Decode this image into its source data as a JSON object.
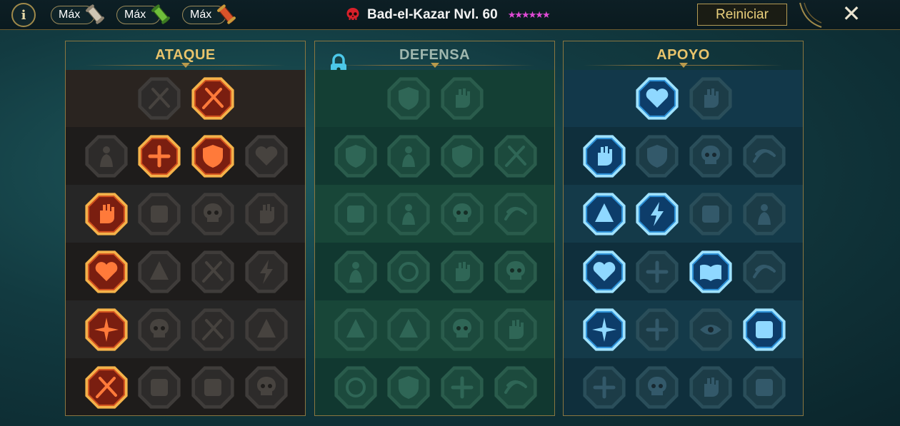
{
  "topbar": {
    "info_label": "i",
    "max_buttons": [
      {
        "label": "Máx",
        "scroll": "scroll-grey-icon"
      },
      {
        "label": "Máx",
        "scroll": "scroll-green-icon"
      },
      {
        "label": "Máx",
        "scroll": "scroll-red-icon"
      }
    ],
    "champion_name": "Bad-el-Kazar Nvl. 60",
    "stars": "★★★★★★",
    "reset_label": "Reiniciar",
    "close_label": "✕"
  },
  "panels": [
    {
      "key": "attack",
      "title": "ATAQUE",
      "locked": false,
      "active_color": "#d2501e",
      "rows": [
        [
          null,
          "swords-cross-icon",
          "flame-slash-icon",
          null
        ],
        [
          "horned-figure-icon",
          "triple-arrow-icon",
          "shield-arrow-icon",
          "cursed-heart-icon"
        ],
        [
          "fist-impact-icon",
          "fangs-icon",
          "skull-cloak-icon",
          "hand-claw-icon"
        ],
        [
          "bleeding-heart-icon",
          "gauntlet-icon",
          "axe-icon",
          "lightning-chains-icon"
        ],
        [
          "burst-strike-icon",
          "skull-group-icon",
          "sword-circle-icon",
          "warrior-stance-icon"
        ],
        [
          "sword-sparkle-icon",
          "knight-helm-icon",
          "demon-icon",
          "spartan-skull-icon"
        ]
      ],
      "active": [
        "0-2",
        "1-1",
        "1-2",
        "2-0",
        "3-0",
        "4-0",
        "5-0"
      ]
    },
    {
      "key": "defense",
      "title": "DEFENSA",
      "locked": true,
      "active_color": "#2a8a66",
      "rows": [
        [
          null,
          "armor-plate-icon",
          "raised-fist-icon",
          null
        ],
        [
          "tusk-shield-icon",
          "hooded-figure-icon",
          "armored-knight-icon",
          "crossed-blades-icon"
        ],
        [
          "spine-icon",
          "banner-knight-icon",
          "skull-heart-icon",
          "monk-icon"
        ],
        [
          "rising-figure-icon",
          "hourglass-icon",
          "open-palm-icon",
          "bull-skull-icon"
        ],
        [
          "running-figure-icon",
          "tri-claw-icon",
          "skull-sun-icon",
          "swirl-hand-icon"
        ],
        [
          "flaming-warrior-icon",
          "shield-wings-icon",
          "bearded-face-icon",
          "meditating-icon"
        ]
      ],
      "active": []
    },
    {
      "key": "support",
      "title": "APOYO",
      "locked": false,
      "active_color": "#2b8fd6",
      "rows": [
        [
          null,
          "heart-plus-icon",
          "knotted-hands-icon",
          null
        ],
        [
          "praying-hands-icon",
          "shield-rings-icon",
          "skull-smoke-icon",
          "speed-foot-icon"
        ],
        [
          "blessed-figure-icon",
          "lightning-bolt-icon",
          "kicking-leg-icon",
          "shadow-figure-icon"
        ],
        [
          "chained-heart-icon",
          "meteor-icon",
          "open-book-icon",
          "angry-face-icon"
        ],
        [
          "star-compass-icon",
          "running-foot-icon",
          "eye-icon",
          "voodoo-doll-icon"
        ],
        [
          "potion-icon",
          "skull-crossbones-icon",
          "fist-down-icon",
          "eagle-icon"
        ]
      ],
      "active": [
        "0-1",
        "1-0",
        "2-0",
        "2-1",
        "3-0",
        "3-2",
        "4-0",
        "4-3"
      ]
    }
  ]
}
